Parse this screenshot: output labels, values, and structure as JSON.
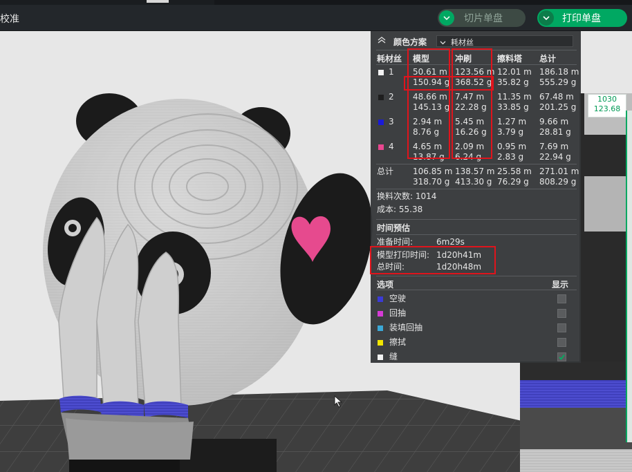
{
  "app": {
    "title": "校准"
  },
  "buttons": {
    "slice_label": "切片单盘",
    "print_label": "打印单盘"
  },
  "panel": {
    "scheme_label": "颜色方案",
    "scheme_value": "耗材丝",
    "columns": {
      "filament": "耗材丝",
      "model": "模型",
      "flush": "冲刷",
      "tower": "擦料塔",
      "total": "总计"
    },
    "filaments": [
      {
        "id": "1",
        "color": "#f2f2f2",
        "model_m": "50.61 m",
        "model_g": "150.94 g",
        "flush_m": "123.56 m",
        "flush_g": "368.52 g",
        "tower_m": "12.01 m",
        "tower_g": "35.82 g",
        "total_m": "186.18 m",
        "total_g": "555.29 g"
      },
      {
        "id": "2",
        "color": "#1e1e1e",
        "model_m": "48.66 m",
        "model_g": "145.13 g",
        "flush_m": "7.47 m",
        "flush_g": "22.28 g",
        "tower_m": "11.35 m",
        "tower_g": "33.85 g",
        "total_m": "67.48 m",
        "total_g": "201.25 g"
      },
      {
        "id": "3",
        "color": "#1a1ad8",
        "model_m": "2.94 m",
        "model_g": "8.76 g",
        "flush_m": "5.45 m",
        "flush_g": "16.26 g",
        "tower_m": "1.27 m",
        "tower_g": "3.79 g",
        "total_m": "9.66 m",
        "total_g": "28.81 g"
      },
      {
        "id": "4",
        "color": "#e8478f",
        "model_m": "4.65 m",
        "model_g": "13.87 g",
        "flush_m": "2.09 m",
        "flush_g": "6.24 g",
        "tower_m": "0.95 m",
        "tower_g": "2.83 g",
        "total_m": "7.69 m",
        "total_g": "22.94 g"
      }
    ],
    "sum": {
      "label": "总计",
      "model_m": "106.85 m",
      "model_g": "318.70 g",
      "flush_m": "138.57 m",
      "flush_g": "413.30 g",
      "tower_m": "25.58 m",
      "tower_g": "76.29 g",
      "total_m": "271.01 m",
      "total_g": "808.29 g"
    },
    "changes": "换料次数: 1014",
    "cost": "成本: 55.38",
    "time_header": "时间预估",
    "prep_label": "准备时间:",
    "prep_value": "6m29s",
    "model_time_label": "模型打印时间:",
    "model_time_value": "1d20h41m",
    "total_time_label": "总时间:",
    "total_time_value": "1d20h48m",
    "options_header": "选项",
    "display_header": "显示",
    "options": [
      {
        "label": "空驶",
        "color": "#3b3bd6"
      },
      {
        "label": "回抽",
        "color": "#d63bd6"
      },
      {
        "label": "装填回抽",
        "color": "#3ba8d6"
      },
      {
        "label": "擦拭",
        "color": "#f2e600"
      },
      {
        "label": "缝",
        "color": "#f2f2f2"
      }
    ]
  },
  "slider": {
    "top_layer": "1030",
    "top_height": "123.68"
  }
}
